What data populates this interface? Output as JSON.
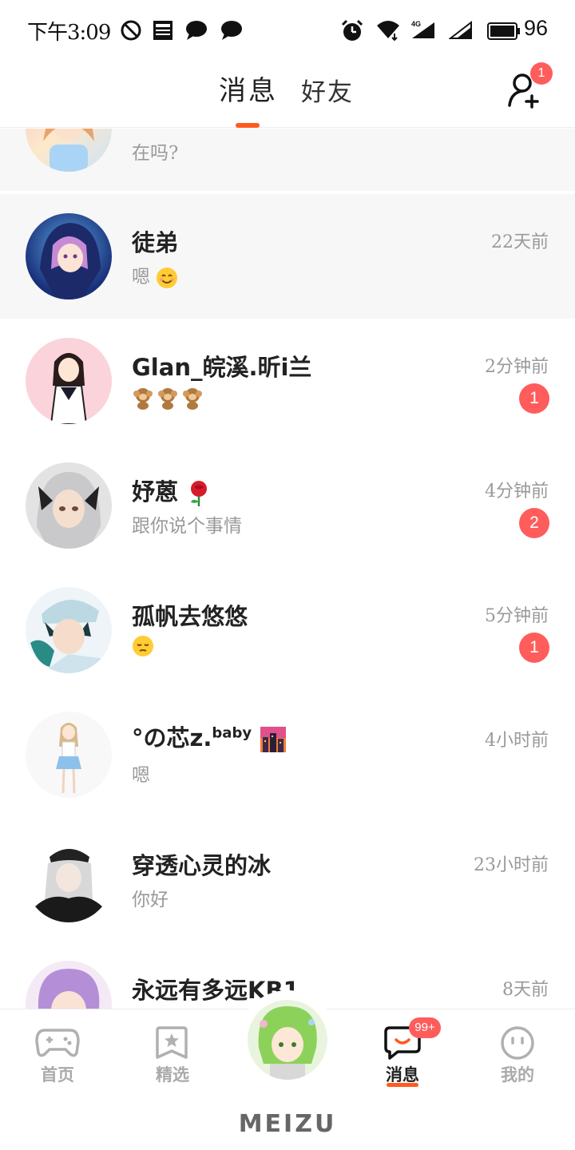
{
  "status_bar": {
    "time": "下午3:09",
    "battery": "96",
    "network": "4G"
  },
  "header": {
    "tab_messages": "消息",
    "tab_friends": "好友",
    "add_friend_badge": "1",
    "accent_color": "#ff5a1f"
  },
  "conversations": [
    {
      "name": "",
      "preview": "在吗?",
      "time": "",
      "unread": "",
      "highlighted": true
    },
    {
      "name": "徒弟",
      "preview": "嗯",
      "time": "22天前",
      "unread": "",
      "highlighted": true
    },
    {
      "name": "Glan_皖溪.昕i兰",
      "preview": "",
      "time": "2分钟前",
      "unread": "1",
      "highlighted": false
    },
    {
      "name": "妤蒽",
      "preview": "跟你说个事情",
      "time": "4分钟前",
      "unread": "2",
      "highlighted": false
    },
    {
      "name": "孤帆去悠悠",
      "preview": "",
      "time": "5分钟前",
      "unread": "1",
      "highlighted": false
    },
    {
      "name": "°の芯z.",
      "name_sup": "baby",
      "preview": "嗯",
      "time": "4小时前",
      "unread": "",
      "highlighted": false
    },
    {
      "name": "穿透心灵的冰",
      "preview": "你好",
      "time": "23小时前",
      "unread": "",
      "highlighted": false
    },
    {
      "name": "永远有多远KB1",
      "preview": "",
      "time": "8天前",
      "unread": "",
      "highlighted": false
    }
  ],
  "bottom_nav": {
    "home": "首页",
    "featured": "精选",
    "messages": "消息",
    "messages_badge": "99+",
    "mine": "我的"
  },
  "brand": "MEIZU",
  "colors": {
    "badge": "#ff5c5c",
    "accent": "#ff5a1f"
  }
}
